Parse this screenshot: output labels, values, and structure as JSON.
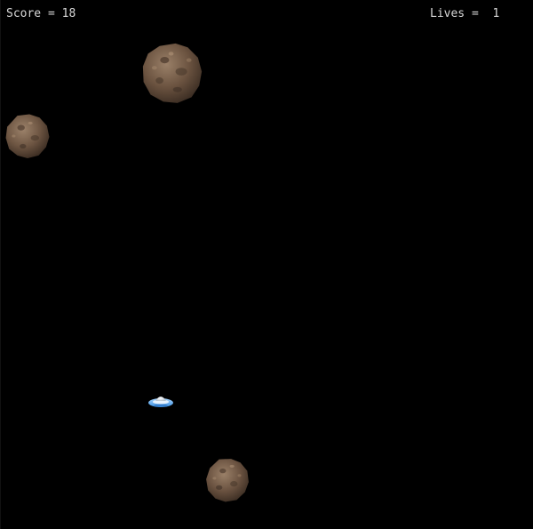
{
  "hud": {
    "score_text": "Score = 18",
    "lives_text": "Lives =  1"
  },
  "game": {
    "score": 18,
    "lives": 1,
    "asteroid_count": 3,
    "background_color": "#000000",
    "hud_color": "#d8d8d8"
  },
  "sprites": {
    "player": "ufo-ship-icon",
    "enemy": "asteroid-icon"
  }
}
